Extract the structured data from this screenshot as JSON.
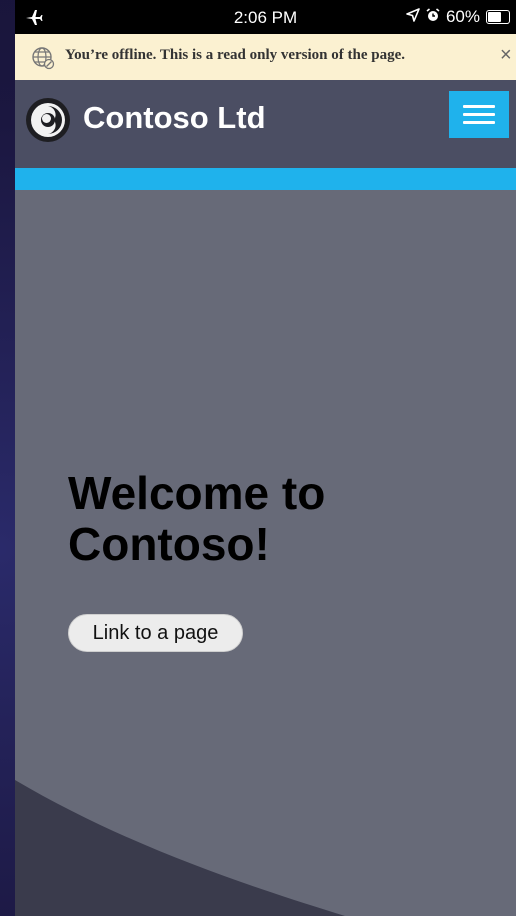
{
  "status_bar": {
    "time": "2:06 PM",
    "battery": "60%",
    "battery_level": 0.6
  },
  "offline_banner": {
    "message": "You’re offline. This is a read only version of the page.",
    "close_glyph": "×",
    "icon": "globe-offline-icon"
  },
  "header": {
    "brand": "Contoso Ltd",
    "logo_icon": "contoso-logo-icon",
    "menu_icon": "hamburger-menu-icon",
    "accent_color": "#1fb2ec",
    "background_color": "#4b4e63"
  },
  "hero": {
    "title": "Welcome to Contoso!",
    "link_label": "Link to a page",
    "background_color": "#676a78"
  }
}
